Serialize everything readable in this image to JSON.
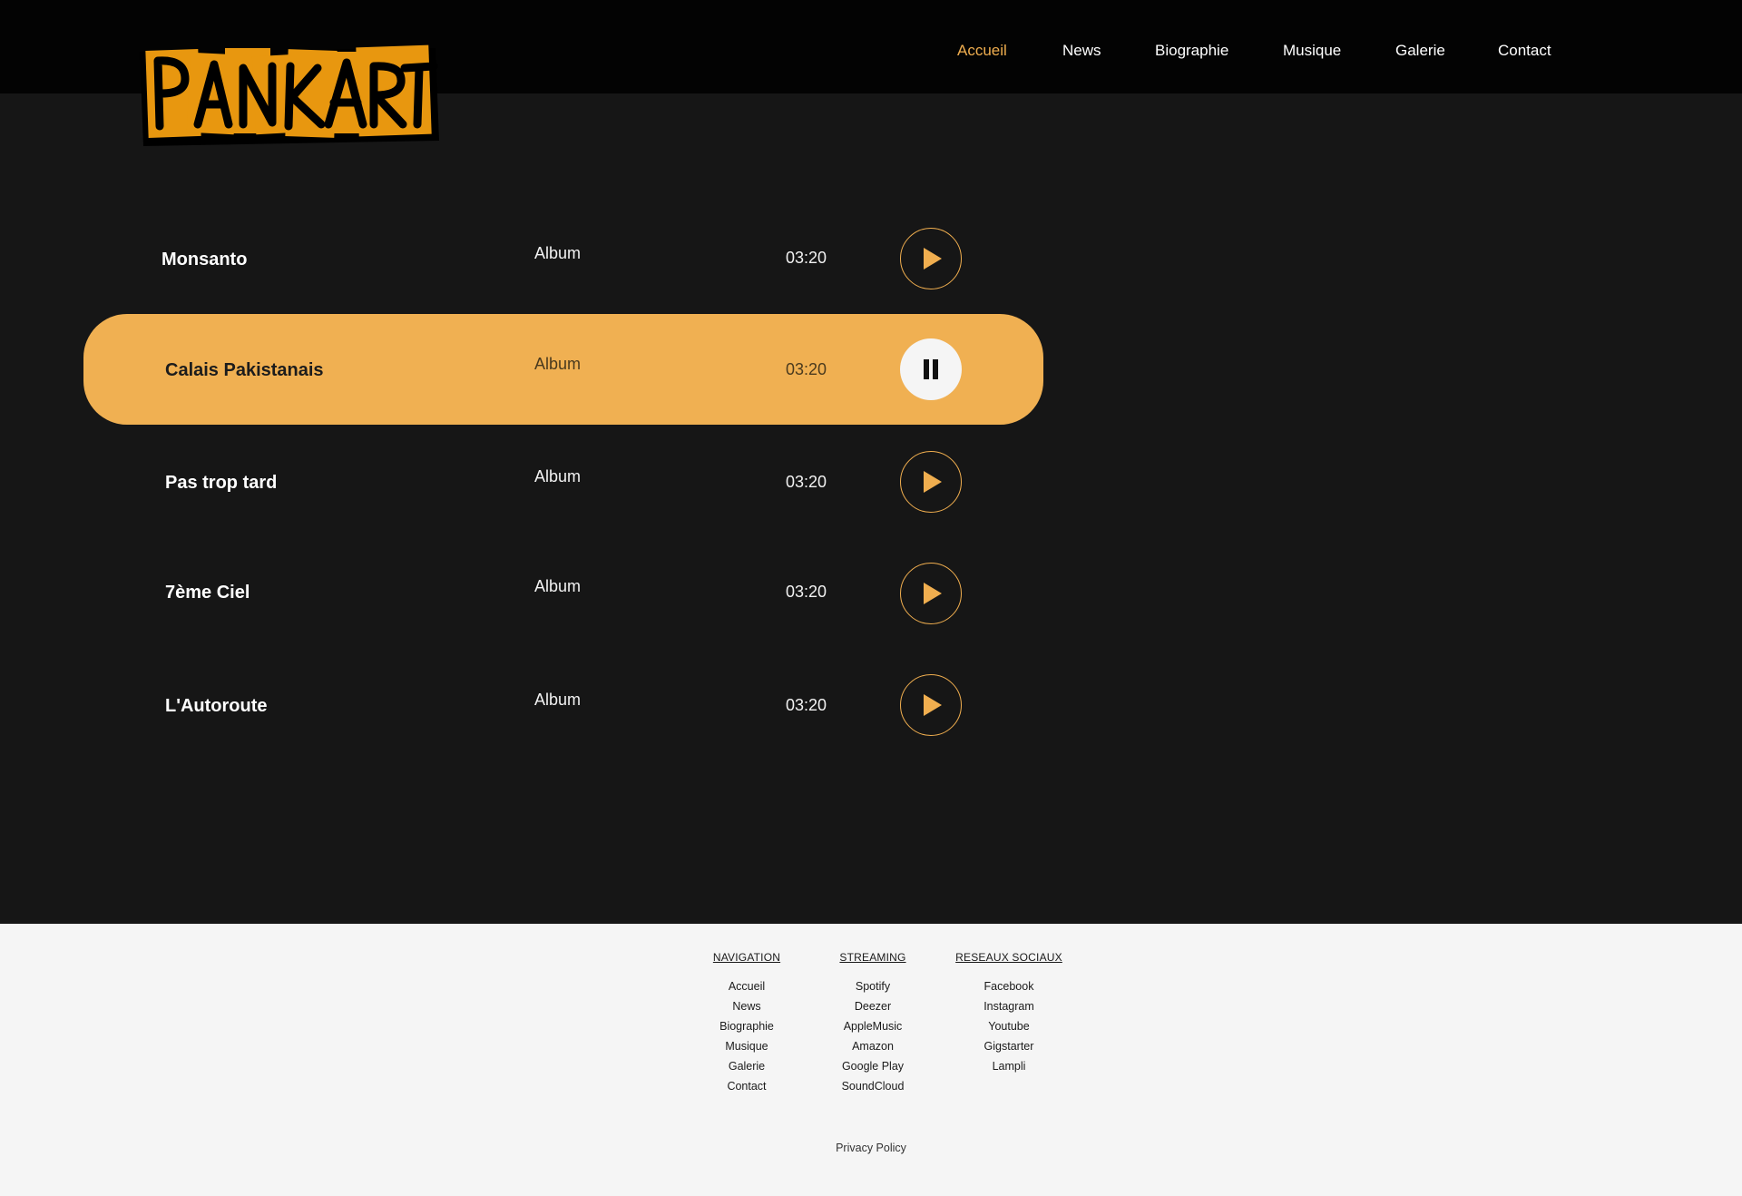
{
  "brand": {
    "logo_text": "PANKART",
    "accent": "#f0ae4f",
    "logo_color": "#e8970f"
  },
  "nav": {
    "items": [
      {
        "label": "Accueil",
        "active": true
      },
      {
        "label": "News"
      },
      {
        "label": "Biographie"
      },
      {
        "label": "Musique"
      },
      {
        "label": "Galerie"
      },
      {
        "label": "Contact"
      }
    ]
  },
  "tracks": [
    {
      "title": "Monsanto",
      "album": "Album",
      "duration": "03:20",
      "state": "play-icon"
    },
    {
      "title": "Calais Pakistanais",
      "album": "Album",
      "duration": "03:20",
      "state": "pause-icon",
      "active": true
    },
    {
      "title": "Pas trop tard",
      "album": "Album",
      "duration": "03:20",
      "state": "play-icon"
    },
    {
      "title": "7ème Ciel",
      "album": "Album",
      "duration": "03:20",
      "state": "play-icon"
    },
    {
      "title": "L'Autoroute",
      "album": "Album",
      "duration": "03:20",
      "state": "play-icon"
    }
  ],
  "footer": {
    "navigation": {
      "title": "NAVIGATION",
      "links": [
        "Accueil",
        "News",
        "Biographie",
        "Musique",
        "Galerie",
        "Contact"
      ]
    },
    "streaming": {
      "title": "STREAMING",
      "links": [
        "Spotify",
        "Deezer",
        "AppleMusic",
        "Amazon",
        "Google Play",
        "SoundCloud"
      ]
    },
    "social": {
      "title": "RESEAUX SOCIAUX",
      "links": [
        "Facebook",
        "Instagram",
        "Youtube",
        "Gigstarter",
        "Lampli"
      ]
    },
    "privacy": "Privacy Policy"
  }
}
